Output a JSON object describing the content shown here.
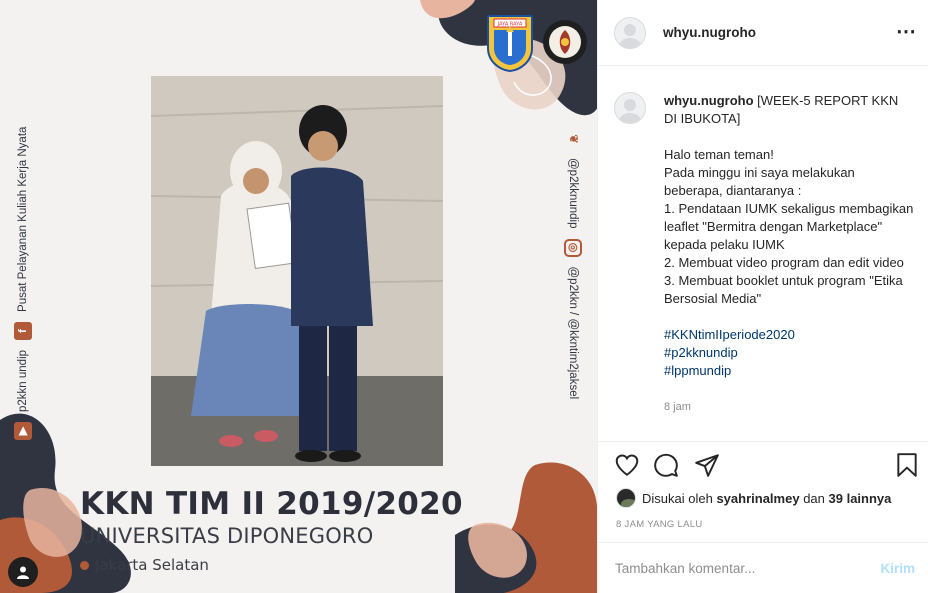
{
  "poster": {
    "heading": "KKN TIM II 2019/2020",
    "subheading": "UNIVERSITAS DIPONEGORO",
    "location": "Jakarta Selatan",
    "left_vertical": {
      "text1": "Pusat Pelayanan Kuliah Kerja Nyata",
      "text2": "p2kkn undip",
      "text3": "p2kkn.undip"
    },
    "right_vertical": {
      "text1": "@p2kknundip",
      "text2": "@p2kkn / @kkntim2jaksel"
    },
    "logo_left_text": "JAYA RAYA",
    "colors": {
      "accent": "#b05a3a",
      "dark": "#2d2f3a",
      "peach": "#e7b49f"
    }
  },
  "header": {
    "username": "whyu.nugroho",
    "more_icon": "⋯"
  },
  "caption": {
    "username": "whyu.nugroho",
    "title": "[WEEK-5 REPORT KKN DI IBUKOTA]",
    "lines_para1": [
      "Halo teman teman!",
      "Pada minggu ini saya melakukan beberapa, diantaranya :",
      "1. Pendataan IUMK sekaligus membagikan leaflet \"Bermitra dengan Marketplace\" kepada pelaku IUMK",
      "2. Membuat video program dan edit video",
      "3. Membuat booklet untuk program \"Etika Bersosial Media\""
    ],
    "hashtags": [
      "#KKNtimIIperiode2020",
      "#p2kknundip",
      "#lppmundip"
    ],
    "time_ago": "8 jam"
  },
  "actions": {
    "like_icon": "heart-icon",
    "comment_icon": "comment-icon",
    "share_icon": "share-icon",
    "save_icon": "bookmark-icon"
  },
  "likes": {
    "prefix": "Disukai oleh",
    "user": "syahrinalmey",
    "connector": "dan",
    "others": "39 lainnya"
  },
  "post_date": "8 JAM YANG LALU",
  "comment": {
    "placeholder": "Tambahkan komentar...",
    "post_label": "Kirim"
  }
}
